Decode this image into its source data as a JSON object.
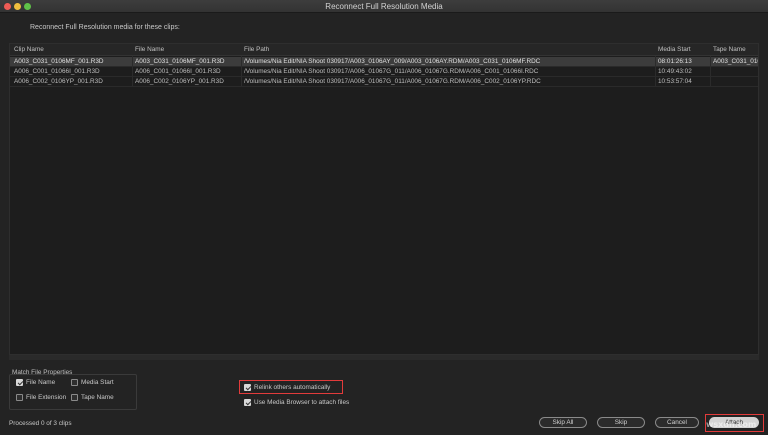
{
  "window": {
    "title": "Reconnect Full Resolution Media"
  },
  "subtitle": "Reconnect Full Resolution media for these clips:",
  "table": {
    "columns": [
      "Clip Name",
      "File Name",
      "File Path",
      "Media Start",
      "Tape Name"
    ],
    "rows": [
      [
        "A003_C031_0106MF_001.R3D",
        "A003_C031_0106MF_001.R3D",
        "/Volumes/Nia Edit/NIA Shoot 030917/A003_0106AY_009/A003_0106AY.RDM/A003_C031_0106MF.RDC",
        "08:01:26:13",
        "A003_C031_010"
      ],
      [
        "A006_C001_01066I_001.R3D",
        "A006_C001_01066I_001.R3D",
        "/Volumes/Nia Edit/NIA Shoot 030917/A006_01067G_011/A006_01067G.RDM/A006_C001_01066I.RDC",
        "10:49:43:02",
        ""
      ],
      [
        "A006_C002_0106YP_001.R3D",
        "A006_C002_0106YP_001.R3D",
        "/Volumes/Nia Edit/NIA Shoot 030917/A006_01067G_011/A006_01067G.RDM/A006_C002_0106YP.RDC",
        "10:53:57:04",
        ""
      ]
    ],
    "selected_row": 0
  },
  "match_properties": {
    "label": "Match File Properties",
    "file_name": {
      "label": "File Name",
      "checked": true
    },
    "media_start": {
      "label": "Media Start",
      "checked": false
    },
    "file_extension": {
      "label": "File Extension",
      "checked": false
    },
    "tape_name": {
      "label": "Tape Name",
      "checked": false
    }
  },
  "options": {
    "relink_others": {
      "label": "Relink others automatically",
      "checked": true
    },
    "media_browser": {
      "label": "Use Media Browser to attach files",
      "checked": true
    }
  },
  "status": "Processed 0 of 3 clips",
  "buttons": {
    "skip_all": "Skip All",
    "skip": "Skip",
    "cancel": "Cancel",
    "attach": "Attach"
  },
  "watermark": "wsxdn.com",
  "colors": {
    "highlight": "#e23b3b",
    "selected_row": "#3c3c3c"
  }
}
